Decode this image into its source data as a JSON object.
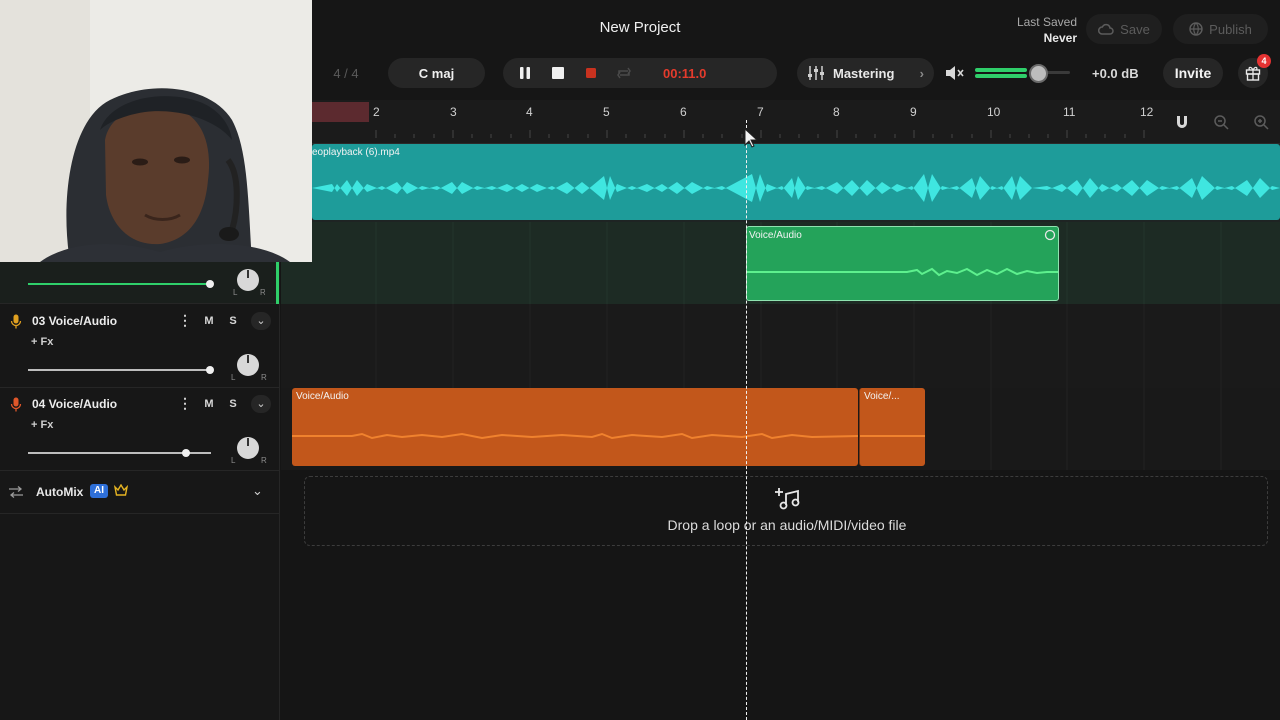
{
  "header": {
    "project_title": "New Project",
    "last_saved_label": "Last Saved",
    "last_saved_value": "Never",
    "save_label": "Save",
    "publish_label": "Publish"
  },
  "transport": {
    "time_signature": "4 / 4",
    "key": "C maj",
    "time": "00:11.0",
    "mastering_label": "Mastering",
    "volume_db": "+0.0 dB",
    "volume_level": 0.65,
    "invite_label": "Invite",
    "gift_badge": "4"
  },
  "ruler": {
    "ticks": [
      "2",
      "3",
      "4",
      "5",
      "6",
      "7",
      "8",
      "9",
      "10",
      "11",
      "12"
    ]
  },
  "tracks": [
    {
      "number_name": "03  Voice/Audio",
      "mute": "M",
      "solo": "S",
      "fx": "+ Fx",
      "fader": 1.0,
      "knob_l": "L",
      "knob_r": "R"
    },
    {
      "number_name": "04  Voice/Audio",
      "mute": "M",
      "solo": "S",
      "fx": "+ Fx",
      "fader": 0.85,
      "knob_l": "L",
      "knob_r": "R"
    }
  ],
  "track2_partial": {
    "fader": 1.0,
    "knob_l": "L",
    "knob_r": "R"
  },
  "automix": {
    "label": "AutoMix",
    "badge": "AI"
  },
  "clips": {
    "video_clip": "eoplayback (6).mp4",
    "green_clip": "Voice/Audio",
    "orange_clip_1": "Voice/Audio",
    "orange_clip_2": "Voice/..."
  },
  "drop_zone": {
    "text": "Drop a loop or an audio/MIDI/video file"
  },
  "colors": {
    "teal_clip": "#1e9c9a",
    "teal_wave": "#3fe6e0",
    "green_clip": "#24a35a",
    "orange_clip": "#c2571b",
    "record_red": "#e53b2c",
    "accent_green": "#2fcf6a"
  }
}
